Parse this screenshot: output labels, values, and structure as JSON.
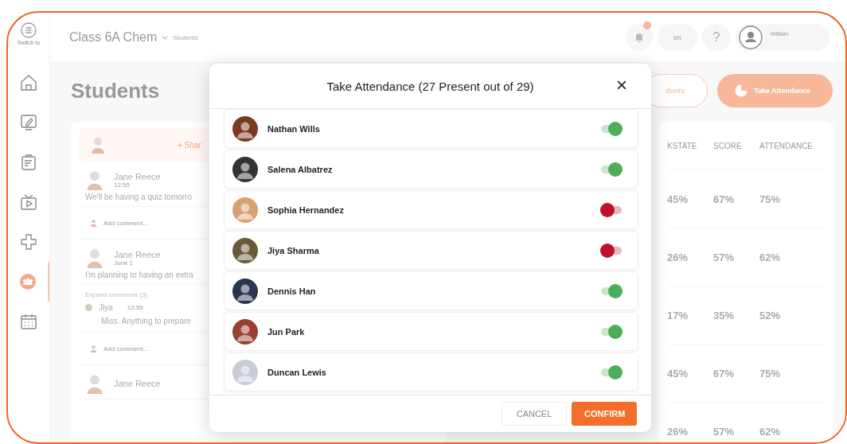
{
  "sidebar": {
    "switch_label": "Switch to",
    "items": [
      {
        "selected": false
      },
      {
        "selected": false
      },
      {
        "selected": false
      },
      {
        "selected": false
      },
      {
        "selected": false
      },
      {
        "selected": true
      },
      {
        "selected": false
      }
    ]
  },
  "header": {
    "class_name": "Class 6A Chem",
    "breadcrumb": "Students",
    "language": "EN",
    "help": "?",
    "user": {
      "name": "William"
    }
  },
  "page_title": "Students",
  "actions": [
    {
      "kind": "outline",
      "label": "dents"
    },
    {
      "kind": "filled",
      "label": "Take Attendance"
    }
  ],
  "feed": {
    "share_label": "+ Shar",
    "items": [
      {
        "kind": "post",
        "author": "Jane Reece",
        "time": "12:55",
        "text": "We'll be having a quiz tomorro"
      },
      {
        "kind": "comment_box",
        "placeholder": "Add comment..."
      },
      {
        "kind": "post",
        "author": "Jane Reece",
        "time": "June 1",
        "text": "I'm planning to having an extra"
      },
      {
        "kind": "expand",
        "label": "Expand comments (3)"
      },
      {
        "kind": "reply",
        "author": "Jiya",
        "time": "12:55",
        "text": "Miss. Anything to prepare"
      },
      {
        "kind": "comment_box",
        "placeholder": "Add comment..."
      },
      {
        "kind": "post",
        "author": "Jane Reece"
      }
    ]
  },
  "table": {
    "columns": [
      "KSTATE",
      "SCORE",
      "ATTENDANCE"
    ],
    "rows": [
      [
        "45%",
        "67%",
        "75%"
      ],
      [
        "26%",
        "57%",
        "62%"
      ],
      [
        "17%",
        "35%",
        "52%"
      ],
      [
        "45%",
        "67%",
        "75%"
      ],
      [
        "26%",
        "57%",
        "62%"
      ]
    ]
  },
  "dialog": {
    "title": "Take Attendance (27 Present out of 29)",
    "close": "×",
    "students": [
      {
        "name": "Nathan Wills",
        "present": true,
        "color": "#7a3a22"
      },
      {
        "name": "Salena Albatrez",
        "present": true,
        "color": "#333333"
      },
      {
        "name": "Sophia Hernandez",
        "present": false,
        "color": "#d9a070"
      },
      {
        "name": "Jiya Sharma",
        "present": false,
        "color": "#6b5a3a"
      },
      {
        "name": "Dennis Han",
        "present": true,
        "color": "#2a3550"
      },
      {
        "name": "Jun Park",
        "present": true,
        "color": "#9a4030"
      },
      {
        "name": "Duncan Lewis",
        "present": true,
        "color": "#c8ccd6"
      }
    ],
    "buttons": [
      {
        "kind": "secondary",
        "label": "CANCEL"
      },
      {
        "kind": "primary",
        "label": "CONFIRM"
      }
    ]
  }
}
